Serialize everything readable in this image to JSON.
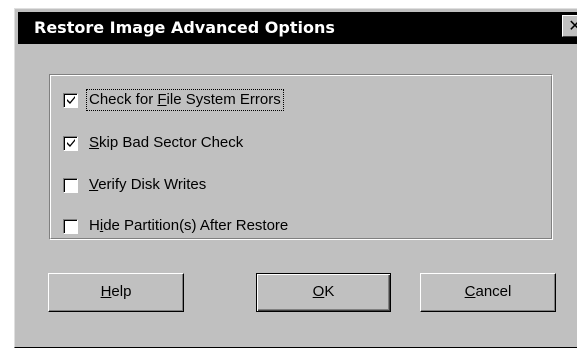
{
  "dialog": {
    "title": "Restore Image Advanced Options",
    "close_glyph": "✕"
  },
  "options": [
    {
      "pre": "Check for ",
      "accel": "F",
      "post": "ile System Errors",
      "checked": true,
      "focused": true
    },
    {
      "pre": "",
      "accel": "S",
      "post": "kip Bad Sector Check",
      "checked": true,
      "focused": false
    },
    {
      "pre": "",
      "accel": "V",
      "post": "erify Disk Writes",
      "checked": false,
      "focused": false
    },
    {
      "pre": "H",
      "accel": "i",
      "post": "de Partition(s) After Restore",
      "checked": false,
      "focused": false
    }
  ],
  "buttons": {
    "help": {
      "accel": "H",
      "rest": "elp"
    },
    "ok": {
      "accel": "O",
      "rest": "K"
    },
    "cancel": {
      "accel": "C",
      "rest": "ancel"
    }
  },
  "colors": {
    "dialog_face": "#c0c0c0",
    "titlebar": "#000000",
    "title_text": "#ffffff"
  }
}
